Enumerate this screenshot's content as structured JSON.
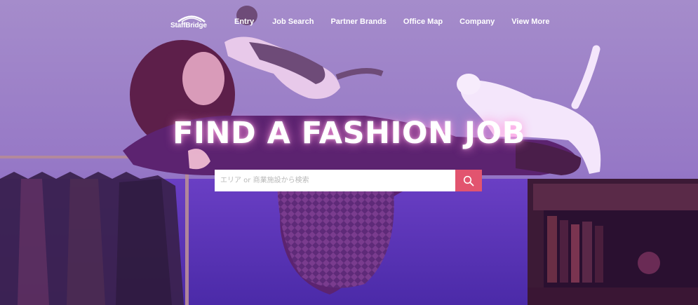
{
  "brand": {
    "logo_text": "StaffBridge"
  },
  "nav": {
    "items": [
      {
        "label": "Entry"
      },
      {
        "label": "Job Search"
      },
      {
        "label": "Partner Brands"
      },
      {
        "label": "Office Map"
      },
      {
        "label": "Company"
      },
      {
        "label": "View More"
      }
    ]
  },
  "hero": {
    "headline": "FIND A FASHION JOB"
  },
  "search": {
    "placeholder": "エリア or 商業施設から検索",
    "button_icon": "search-icon"
  },
  "colors": {
    "search_button": "#e2546f",
    "background": "#9a7cc4",
    "text": "#ffffff"
  }
}
